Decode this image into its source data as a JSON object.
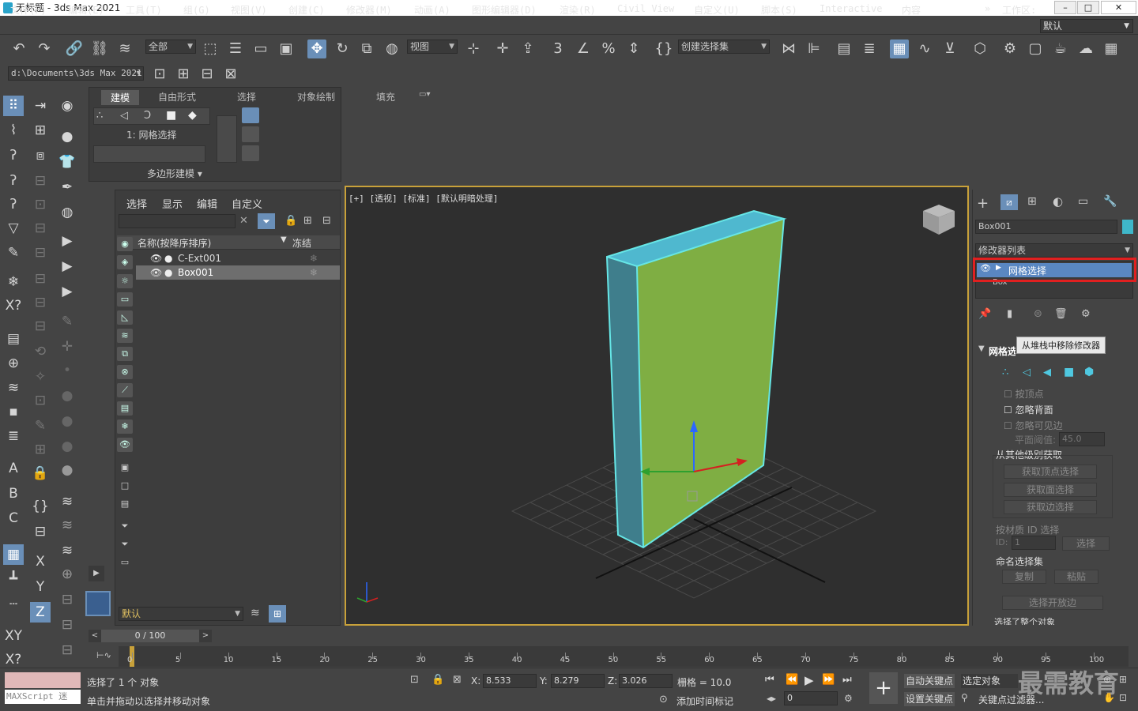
{
  "window": {
    "title": "无标题 - 3ds Max 2021",
    "min": "–",
    "max": "□",
    "close": "✕"
  },
  "menu": [
    "文件(F)",
    "编辑(E)",
    "工具(T)",
    "组(G)",
    "视图(V)",
    "创建(C)",
    "修改器(M)",
    "动画(A)",
    "图形编辑器(D)",
    "渲染(R)",
    "Civil View",
    "自定义(U)",
    "脚本(S)",
    "Interactive",
    "内容"
  ],
  "workspace": {
    "label": "工作区:",
    "value": "默认",
    "chevron": "»"
  },
  "toolbar": {
    "filter_value": "全部",
    "refcoord_value": "视图",
    "selset_placeholder": "创建选择集"
  },
  "path": {
    "value": "d:\\Documents\\3ds Max 2021"
  },
  "ribbon": {
    "tabs": [
      "建模",
      "自由形式",
      "选择",
      "对象绘制",
      "填充"
    ],
    "active_tab": "建模",
    "stack_label": "1: 网格选择",
    "panel_label": "多边形建模 ▾"
  },
  "scene_explorer": {
    "tabs": [
      "选择",
      "显示",
      "编辑",
      "自定义"
    ],
    "col_name": "名称(按降序排序)",
    "col_freeze": "冻结",
    "rows": [
      {
        "name": "C-Ext001",
        "selected": false
      },
      {
        "name": "Box001",
        "selected": true
      }
    ],
    "layer_value": "默认"
  },
  "viewport": {
    "label": "[+] [透视] [标准] [默认明暗处理]",
    "colors": {
      "front": "#7fae43",
      "side": "#3f7e8c",
      "top": "#4fb8cf",
      "edge": "#66e6e6"
    }
  },
  "command_panel": {
    "object_name": "Box001",
    "object_color": "#3fb7c9",
    "modifier_list": "修改器列表",
    "stack_items": [
      "网格选择",
      "Box"
    ],
    "tooltip": "从堆栈中移除修改器",
    "rollout_title": "网格选择参数",
    "chk_by_vertex": "按顶点",
    "chk_ignore_back": "忽略背面",
    "chk_ignore_visible": "忽略可见边",
    "planar_label": "平面阈值:",
    "planar_value": "45.0",
    "get_from_label": "从其他级别获取",
    "btn_get_vertex": "获取顶点选择",
    "btn_get_face": "获取面选择",
    "btn_get_edge": "获取边选择",
    "matid_label": "按材质 ID 选择",
    "id_label": "ID:",
    "id_value": "1",
    "select_btn": "选择",
    "named_sel_label": "命名选择集",
    "copy_btn": "复制",
    "paste_btn": "粘贴",
    "select_open_edges": "选择开放边",
    "select_whole": "选择了整个对象"
  },
  "timeline": {
    "frame_display": "0 / 100",
    "ticks": [
      "0",
      "5",
      "10",
      "15",
      "20",
      "25",
      "30",
      "35",
      "40",
      "45",
      "50",
      "55",
      "60",
      "65",
      "70",
      "75",
      "80",
      "85",
      "90",
      "95",
      "100"
    ]
  },
  "status": {
    "selected": "选择了 1 个 对象",
    "prompt": "单击并拖动以选择并移动对象",
    "maxscript": "MAXScript 迷",
    "x_label": "X:",
    "x_value": "8.533",
    "y_label": "Y:",
    "y_value": "8.279",
    "z_label": "Z:",
    "z_value": "3.026",
    "grid": "栅格 = 10.0",
    "add_time_tag": "添加时间标记",
    "auto_key": "自动关键点",
    "selected_obj": "选定对象",
    "set_key": "设置关键点",
    "key_filters": "关键点过滤器...",
    "frame_value": "0"
  },
  "watermark": "最需教育"
}
